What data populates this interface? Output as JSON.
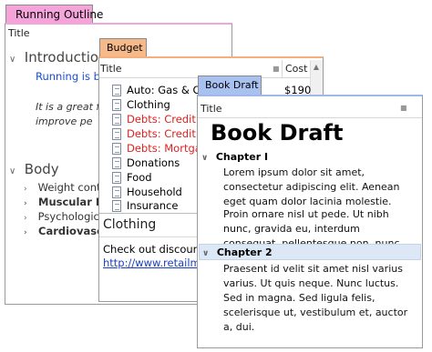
{
  "windows": {
    "running_outline": {
      "tab_label": "Running Outline",
      "header": "Title",
      "intro_heading": "Introduction",
      "intro_link": "Running is bec sport for all age",
      "intro_italic": "It is a great for people control t and improve pe",
      "body_heading": "Body",
      "body_items": [
        {
          "label": "Weight control",
          "bold": false
        },
        {
          "label": "Muscular Deve",
          "bold": true
        },
        {
          "label": "Psychological v",
          "bold": false
        },
        {
          "label": "Cardiovascula",
          "bold": true
        }
      ]
    },
    "budget": {
      "tab_label": "Budget",
      "col_title": "Title",
      "col_cost": "Cost",
      "rows": [
        {
          "label": "Auto: Gas & Oil",
          "red": false
        },
        {
          "label": "Clothing",
          "red": false
        },
        {
          "label": "Debts: Credit Ca",
          "red": true
        },
        {
          "label": "Debts: Credit Ca",
          "red": true
        },
        {
          "label": "Debts: Mortgag",
          "red": true
        },
        {
          "label": "Donations",
          "red": false
        },
        {
          "label": "Food",
          "red": false
        },
        {
          "label": "Household",
          "red": false
        },
        {
          "label": "Insurance",
          "red": false
        }
      ],
      "first_cost": "$190",
      "note_title": "Clothing",
      "note_text": "Check out discount",
      "note_link": "http://www.retailmen"
    },
    "book_draft": {
      "tab_label": "Book Draft",
      "header": "Title",
      "page_title": "Book Draft",
      "chapter1": "Chapter I",
      "ch1_para1": "Lorem ipsum dolor sit amet, consectetur adipiscing elit. Aenean eget quam dolor lacinia molestie.",
      "ch1_para2": "Proin ornare nisl ut pede. Ut nibh nunc, gravida eu, interdum consequat, pellentesque non, nunc.",
      "chapter2": "Chapter 2",
      "ch2_para1": "Praesent id velit sit amet nisl varius varius. Ut quis neque. Nunc luctus. Sed in magna. Sed ligula felis, scelerisque ut, vestibulum et, auctor a, dui."
    }
  },
  "colors": {
    "running_tab": "#f4a4d9",
    "budget_tab": "#f5b98a",
    "book_tab": "#a8c1ef",
    "link_blue": "#1a4fd0",
    "debt_red": "#e02020"
  }
}
